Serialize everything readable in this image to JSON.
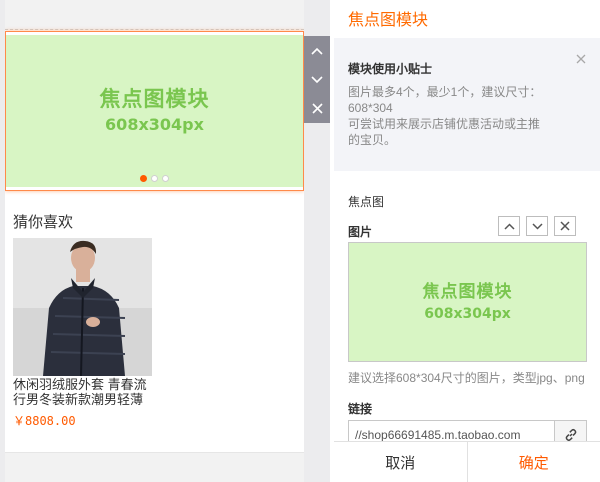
{
  "preview": {
    "slider": {
      "placeholder_title": "焦点图模块",
      "placeholder_size": "608x304px",
      "dot_count": 3,
      "active_dot": 0
    },
    "module_controls": [
      "chevron-up-icon",
      "chevron-down-icon",
      "close-icon"
    ],
    "guess": {
      "title": "猜你喜欢",
      "product": {
        "name": "休闲羽绒服外套 青春流行男冬装新款潮男轻薄",
        "price": "￥8808.00"
      }
    }
  },
  "settings": {
    "title": "焦点图模块",
    "tip": {
      "title": "模块使用小贴士",
      "text": "图片最多4个，最少1个，建议尺寸：608*304\n可尝试用来展示店铺优惠活动或主推的宝贝。"
    },
    "section_label": "焦点图",
    "image_label": "图片",
    "upload_placeholder_title": "焦点图模块",
    "upload_placeholder_size": "608x304px",
    "image_hint": "建议选择608*304尺寸的图片，类型jpg、png",
    "link_label": "链接",
    "link_value": "//shop66691485.m.taobao.com",
    "cancel_label": "取消",
    "confirm_label": "确定"
  },
  "colors": {
    "accent": "#ff5a00",
    "placeholder_bg": "#d8f5c4",
    "placeholder_text": "#7ac64f",
    "control_bg": "#8b8b95"
  }
}
